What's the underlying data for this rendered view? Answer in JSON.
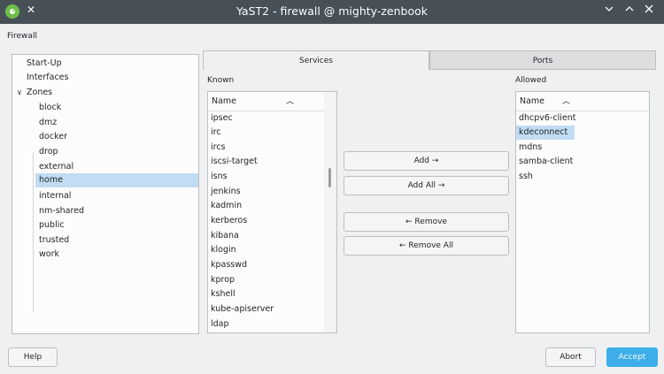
{
  "window": {
    "title": "YaST2 - firewall @ mighty-zenbook"
  },
  "module": {
    "label": "Firewall"
  },
  "tree": {
    "items": [
      {
        "label": "Start-Up"
      },
      {
        "label": "Interfaces"
      },
      {
        "label": "Zones"
      },
      {
        "label": "block"
      },
      {
        "label": "dmz"
      },
      {
        "label": "docker"
      },
      {
        "label": "drop"
      },
      {
        "label": "external"
      },
      {
        "label": "home"
      },
      {
        "label": "internal"
      },
      {
        "label": "nm-shared"
      },
      {
        "label": "public"
      },
      {
        "label": "trusted"
      },
      {
        "label": "work"
      }
    ],
    "selected": "home"
  },
  "tabs": [
    {
      "label": "Services"
    },
    {
      "label": "Ports"
    }
  ],
  "known": {
    "label": "Known",
    "header": "Name",
    "items": [
      "ipsec",
      "irc",
      "ircs",
      "iscsi-target",
      "isns",
      "jenkins",
      "kadmin",
      "kerberos",
      "kibana",
      "klogin",
      "kpasswd",
      "kprop",
      "kshell",
      "kube-apiserver",
      "ldap"
    ]
  },
  "allowed": {
    "label": "Allowed",
    "header": "Name",
    "items": [
      "dhcpv6-client",
      "kdeconnect",
      "mdns",
      "samba-client",
      "ssh"
    ],
    "selected": "kdeconnect"
  },
  "actions": {
    "add": "Add →",
    "add_all": "Add All →",
    "remove": "← Remove",
    "remove_all": "← Remove All"
  },
  "footer": {
    "help": "Help",
    "abort": "Abort",
    "accept": "Accept"
  },
  "colors": {
    "titlebar": "#475057",
    "selection": "#c1dcf3",
    "accent": "#3daee9"
  }
}
